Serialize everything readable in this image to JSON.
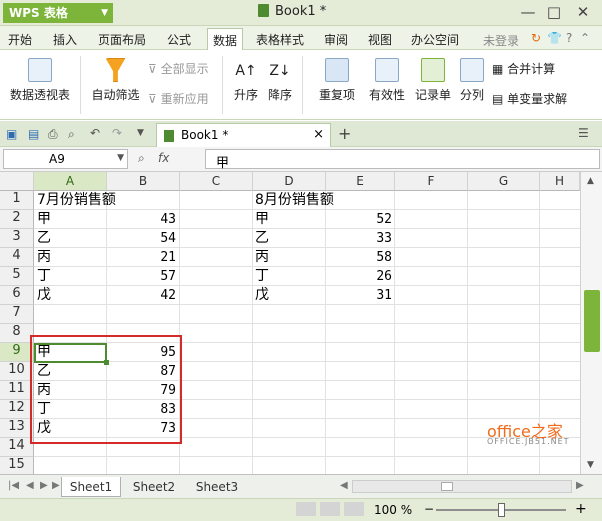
{
  "titlebar": {
    "app_name": "WPS 表格",
    "doc_title": "Book1 *",
    "min": "—",
    "max": "□",
    "close": "✕"
  },
  "menu": {
    "items": [
      "开始",
      "插入",
      "页面布局",
      "公式",
      "数据",
      "表格样式",
      "审阅",
      "视图",
      "办公空间"
    ],
    "active": "数据",
    "login": "未登录"
  },
  "ribbon": {
    "pivot": "数据透视表",
    "autofilter": "自动筛选",
    "show_all": "全部显示",
    "reapply": "重新应用",
    "sort_asc": "升序",
    "sort_desc": "降序",
    "dup": "重复项",
    "validity": "有效性",
    "record": "记录单",
    "split": "分列",
    "consolidate": "合并计算",
    "whatif": "单变量求解"
  },
  "tabs": {
    "doc": "Book1 *",
    "close": "×",
    "new": "+"
  },
  "formula": {
    "namebox": "A9",
    "fx": "fx",
    "value": "甲"
  },
  "grid": {
    "columns": [
      "A",
      "B",
      "C",
      "D",
      "E",
      "F",
      "G",
      "H"
    ],
    "rows": [
      "1",
      "2",
      "3",
      "4",
      "5",
      "6",
      "7",
      "8",
      "9",
      "10",
      "11",
      "12",
      "13",
      "14",
      "15"
    ],
    "selected_column": "A",
    "selected_row": "9",
    "july_title": "7月份销售额",
    "aug_title": "8月份销售额",
    "july": [
      [
        "甲",
        "43"
      ],
      [
        "乙",
        "54"
      ],
      [
        "丙",
        "21"
      ],
      [
        "丁",
        "57"
      ],
      [
        "戊",
        "42"
      ]
    ],
    "aug": [
      [
        "甲",
        "52"
      ],
      [
        "乙",
        "33"
      ],
      [
        "丙",
        "58"
      ],
      [
        "丁",
        "26"
      ],
      [
        "戊",
        "31"
      ]
    ],
    "result": [
      [
        "甲",
        "95"
      ],
      [
        "乙",
        "87"
      ],
      [
        "丙",
        "79"
      ],
      [
        "丁",
        "83"
      ],
      [
        "戊",
        "73"
      ]
    ]
  },
  "sheets": [
    "Sheet1",
    "Sheet2",
    "Sheet3"
  ],
  "active_sheet": "Sheet1",
  "status": {
    "zoom": "100 %"
  },
  "watermark": {
    "line1": "office之家",
    "line2": "OFFICE.JB51.NET"
  },
  "colors": {
    "accent": "#7cb53a",
    "highlight": "#d42a2a"
  }
}
